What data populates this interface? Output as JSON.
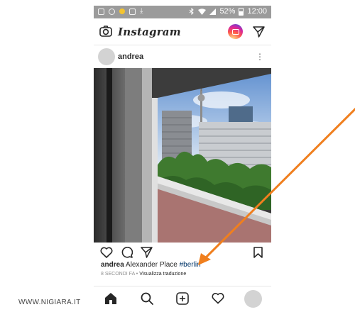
{
  "status_bar": {
    "battery": "52%",
    "time": "12:00"
  },
  "header": {
    "logo": "Instagram",
    "camera_icon": "camera-icon",
    "igtv_icon": "igtv-icon",
    "send_icon": "direct-send-icon"
  },
  "post": {
    "username": "andrea",
    "more_icon": "more-vertical-icon",
    "more_glyph": "⋮",
    "photo_icon": "berlin-alexanderplatz-photo",
    "actions": [
      "heart-icon",
      "comment-icon",
      "share-icon",
      "bookmark-icon"
    ],
    "caption": {
      "username": "andrea",
      "text": " Alexander Place ",
      "hashtag": "#berlin"
    },
    "timestamp": "8 SECONDI FA",
    "separator": " • ",
    "translate_link": "Visualizza traduzione"
  },
  "bottom_nav": [
    "home-icon",
    "search-icon",
    "new-post-icon",
    "activity-heart-icon",
    "profile-avatar"
  ],
  "annotation": {
    "arrow_color": "#f07f1e"
  },
  "watermark": "WWW.NIGIARA.IT"
}
